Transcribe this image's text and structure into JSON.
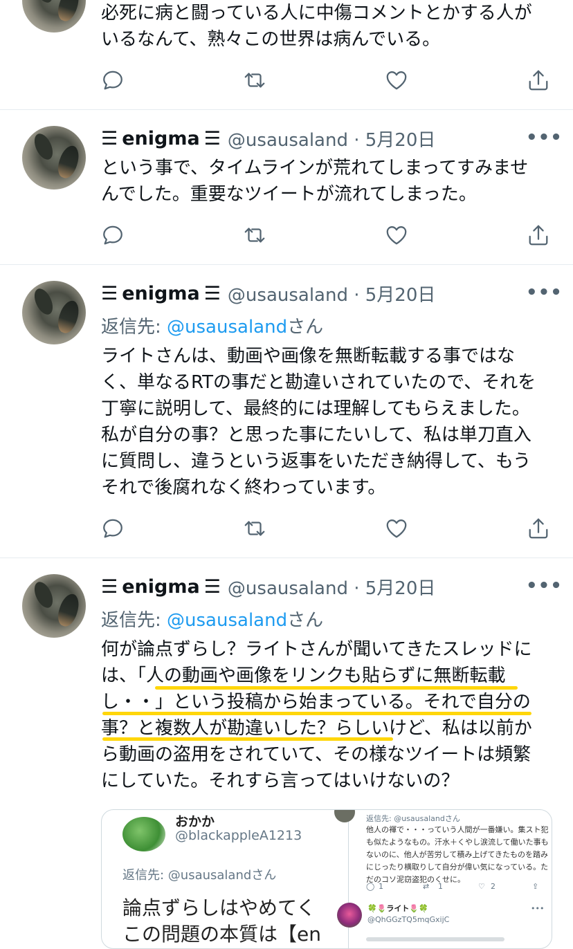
{
  "tweet0": {
    "lines": [
      "必死に病と闘っている人に中傷コメントとかする人が",
      "いるなんて、熟々この世界は病んでいる。"
    ]
  },
  "tweets": [
    {
      "bars": "𝌆",
      "name": "enigma",
      "handle_date": "@usausaland · 5月20日",
      "more": "•••",
      "reply_prefix": "",
      "reply_handle": "",
      "reply_suffix": "",
      "lines": [
        "という事で、タイムラインが荒れてしまってすみませ",
        "んでした。重要なツイートが流れてしまった。"
      ]
    },
    {
      "bars": "𝌆",
      "name": "enigma",
      "handle_date": "@usausaland · 5月20日",
      "more": "•••",
      "reply_prefix": "返信先: ",
      "reply_handle": "@usausaland",
      "reply_suffix": "さん",
      "lines": [
        "ライトさんは、動画や画像を無断転載する事ではな",
        "く、単なるRTの事だと勘違いされていたので、それを",
        "丁寧に説明して、最終的には理解してもらえました。",
        "私が自分の事？と思った事にたいして、私は単刀直入",
        "に質問し、違うという返事をいただき納得して、もう",
        "それで後腐れなく終わっています。"
      ]
    },
    {
      "bars": "𝌆",
      "name": "enigma",
      "handle_date": "@usausaland · 5月20日",
      "more": "•••",
      "reply_prefix": "返信先: ",
      "reply_handle": "@usausaland",
      "reply_suffix": "さん",
      "lines": [
        "何が論点ずらし？ライトさんが聞いてきたスレッドに",
        "は、「人の動画や画像をリンクも貼らずに無断転載",
        "し・・」という投稿から始まっている。それで自分の",
        "事？と複数人が勘違いした？らしいけど、私は以前か",
        "ら動画の盗用をされていて、その様なツイートは頻繁",
        "にしていた。それすら言ってはいけないの？"
      ]
    }
  ],
  "embedded": {
    "left": {
      "name": "おかか",
      "handle": "@blackappleA1213",
      "reply": "返信先: @usausalandさん",
      "text_lines": [
        "論点ずらしはやめてく",
        "この問題の本質は【en"
      ]
    },
    "right": {
      "reply": "返信先: @usausalandさん",
      "text_lines": [
        "他人の褌で・・・っていう人間が一番嫌い。集スト犯",
        "も似たようなもの。汗水＋くやし涙流して働いた事も",
        "ないのに、他人が苦労して積み上げてきたものを踏み",
        "にじったり横取りして自分が偉い気になっている。た",
        "だのコソ泥窃盗犯のくせに。"
      ],
      "counts": {
        "reply": "1",
        "retweet": "1",
        "like": "2"
      },
      "user2_name": "🍀🌷ライト🌷🍀",
      "user2_handle": "@QhGGzTQ5mqGxijC",
      "user2_more": "•••"
    }
  },
  "colors": {
    "text": "#0f1419",
    "secondary": "#536471",
    "link": "#1d9bf0",
    "highlight": "#ffd60a"
  },
  "icons": [
    "reply-icon",
    "retweet-icon",
    "like-icon",
    "share-icon",
    "more-icon"
  ]
}
